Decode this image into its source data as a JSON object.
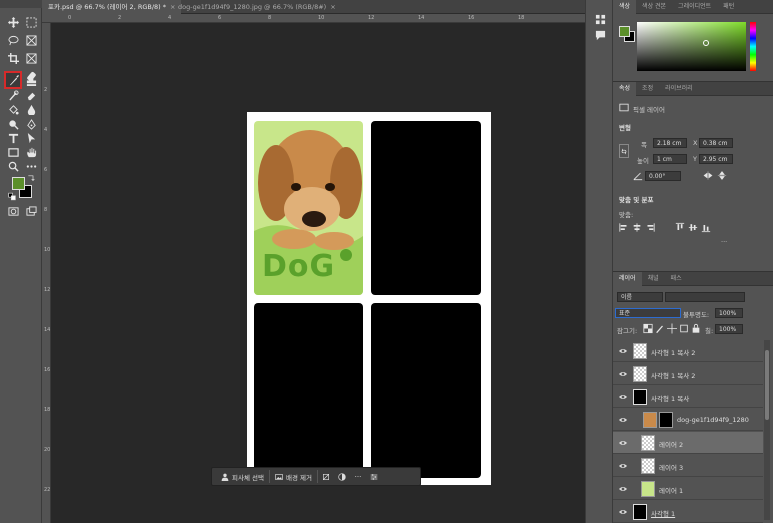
{
  "tabs": [
    {
      "label": "포카.psd @ 66.7% (레이어 2, RGB/8) *",
      "close": "×"
    },
    {
      "label": "dog-ge1f1d94f9_1280.jpg @ 66.7% (RGB/8#)",
      "close": "×"
    }
  ],
  "ruler": {
    "top": [
      "0",
      "2",
      "4",
      "6",
      "8",
      "10",
      "12",
      "14",
      "16",
      "18"
    ],
    "left": [
      "2",
      "4",
      "6",
      "8",
      "10",
      "12",
      "14",
      "16",
      "18",
      "20",
      "22"
    ]
  },
  "artwork": {
    "text": "DoG"
  },
  "context_bar": {
    "select_subject": "피사체 선택",
    "remove_bg": "배경 제거",
    "more": "···"
  },
  "color_panel": {
    "tabs": [
      "색상",
      "색상 견본",
      "그레이디언트",
      "패턴"
    ],
    "fg_color": "#5b8f2a",
    "bg_color": "#000000"
  },
  "properties": {
    "tabs": [
      "속성",
      "조정",
      "라이브러리"
    ],
    "layer_type": "픽셀 레이어",
    "transform_title": "변형",
    "w_label": "폭",
    "w_value": "2.18 cm",
    "x_label": "X",
    "x_value": "0.38 cm",
    "h_label": "높이",
    "h_value": "1 cm",
    "y_label": "Y",
    "y_value": "2.95 cm",
    "angle_value": "0.00°",
    "align_title": "맞춤 및 분포",
    "align_label": "맞춤:",
    "more": "···"
  },
  "layers": {
    "tabs": [
      "레이어",
      "채널",
      "패스"
    ],
    "filter": "이름",
    "blend": "표준",
    "opacity_label": "불투명도:",
    "opacity_value": "100%",
    "lock_label": "잠그기:",
    "fill_label": "칠:",
    "fill_value": "100%",
    "items": [
      {
        "name": "사각형 1 복사 2"
      },
      {
        "name": "사각형 1 복사 2"
      },
      {
        "name": "사각형 1 복사"
      },
      {
        "name": "dog-ge1f1d94f9_1280"
      },
      {
        "name": "레이어 2"
      },
      {
        "name": "레이어 3"
      },
      {
        "name": "레이어 1"
      },
      {
        "name": "사각형 1"
      }
    ]
  }
}
